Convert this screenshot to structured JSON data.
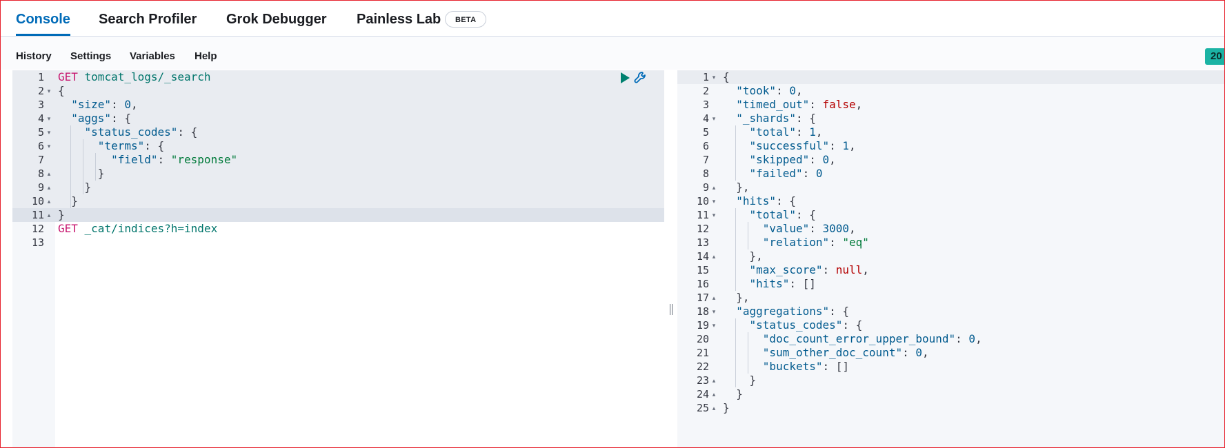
{
  "tabs": [
    {
      "label": "Console",
      "active": true
    },
    {
      "label": "Search Profiler",
      "active": false
    },
    {
      "label": "Grok Debugger",
      "active": false
    },
    {
      "label": "Painless Lab",
      "active": false,
      "badge": "BETA"
    }
  ],
  "toolbar": {
    "items": [
      "History",
      "Settings",
      "Variables",
      "Help"
    ],
    "status": "20"
  },
  "request_editor": {
    "actions": {
      "run": "play-icon",
      "settings": "wrench-icon"
    },
    "lines": [
      {
        "n": "1",
        "fold": "",
        "tokens": [
          {
            "t": "GET",
            "c": "method"
          },
          {
            "t": " tomcat_logs/_search",
            "c": "url"
          }
        ]
      },
      {
        "n": "2",
        "fold": "▾",
        "tokens": [
          {
            "t": "{",
            "c": "punc"
          }
        ]
      },
      {
        "n": "3",
        "fold": "",
        "tokens": [
          {
            "t": "  ",
            "c": "punc"
          },
          {
            "t": "\"size\"",
            "c": "key"
          },
          {
            "t": ": ",
            "c": "punc"
          },
          {
            "t": "0",
            "c": "num"
          },
          {
            "t": ",",
            "c": "punc"
          }
        ]
      },
      {
        "n": "4",
        "fold": "▾",
        "tokens": [
          {
            "t": "  ",
            "c": "punc"
          },
          {
            "t": "\"aggs\"",
            "c": "key"
          },
          {
            "t": ": {",
            "c": "punc"
          }
        ]
      },
      {
        "n": "5",
        "fold": "▾",
        "tokens": [
          {
            "t": "    ",
            "c": "punc"
          },
          {
            "t": "\"status_codes\"",
            "c": "key"
          },
          {
            "t": ": {",
            "c": "punc"
          }
        ]
      },
      {
        "n": "6",
        "fold": "▾",
        "tokens": [
          {
            "t": "      ",
            "c": "punc"
          },
          {
            "t": "\"terms\"",
            "c": "key"
          },
          {
            "t": ": {",
            "c": "punc"
          }
        ]
      },
      {
        "n": "7",
        "fold": "",
        "tokens": [
          {
            "t": "        ",
            "c": "punc"
          },
          {
            "t": "\"field\"",
            "c": "key"
          },
          {
            "t": ": ",
            "c": "punc"
          },
          {
            "t": "\"response\"",
            "c": "str"
          }
        ]
      },
      {
        "n": "8",
        "fold": "▴",
        "tokens": [
          {
            "t": "      }",
            "c": "punc"
          }
        ]
      },
      {
        "n": "9",
        "fold": "▴",
        "tokens": [
          {
            "t": "    }",
            "c": "punc"
          }
        ]
      },
      {
        "n": "10",
        "fold": "▴",
        "tokens": [
          {
            "t": "  }",
            "c": "punc"
          }
        ]
      },
      {
        "n": "11",
        "fold": "▴",
        "tokens": [
          {
            "t": "}",
            "c": "punc"
          }
        ]
      },
      {
        "n": "12",
        "fold": "",
        "tokens": [
          {
            "t": "GET",
            "c": "method"
          },
          {
            "t": " _cat/indices?h=index",
            "c": "url"
          }
        ]
      },
      {
        "n": "13",
        "fold": "",
        "tokens": []
      }
    ]
  },
  "response_editor": {
    "lines": [
      {
        "n": "1",
        "fold": "▾",
        "tokens": [
          {
            "t": "{",
            "c": "punc"
          }
        ]
      },
      {
        "n": "2",
        "fold": "",
        "tokens": [
          {
            "t": "  ",
            "c": "punc"
          },
          {
            "t": "\"took\"",
            "c": "key"
          },
          {
            "t": ": ",
            "c": "punc"
          },
          {
            "t": "0",
            "c": "num"
          },
          {
            "t": ",",
            "c": "punc"
          }
        ]
      },
      {
        "n": "3",
        "fold": "",
        "tokens": [
          {
            "t": "  ",
            "c": "punc"
          },
          {
            "t": "\"timed_out\"",
            "c": "key"
          },
          {
            "t": ": ",
            "c": "punc"
          },
          {
            "t": "false",
            "c": "bool"
          },
          {
            "t": ",",
            "c": "punc"
          }
        ]
      },
      {
        "n": "4",
        "fold": "▾",
        "tokens": [
          {
            "t": "  ",
            "c": "punc"
          },
          {
            "t": "\"_shards\"",
            "c": "key"
          },
          {
            "t": ": {",
            "c": "punc"
          }
        ]
      },
      {
        "n": "5",
        "fold": "",
        "tokens": [
          {
            "t": "    ",
            "c": "punc"
          },
          {
            "t": "\"total\"",
            "c": "key"
          },
          {
            "t": ": ",
            "c": "punc"
          },
          {
            "t": "1",
            "c": "num"
          },
          {
            "t": ",",
            "c": "punc"
          }
        ]
      },
      {
        "n": "6",
        "fold": "",
        "tokens": [
          {
            "t": "    ",
            "c": "punc"
          },
          {
            "t": "\"successful\"",
            "c": "key"
          },
          {
            "t": ": ",
            "c": "punc"
          },
          {
            "t": "1",
            "c": "num"
          },
          {
            "t": ",",
            "c": "punc"
          }
        ]
      },
      {
        "n": "7",
        "fold": "",
        "tokens": [
          {
            "t": "    ",
            "c": "punc"
          },
          {
            "t": "\"skipped\"",
            "c": "key"
          },
          {
            "t": ": ",
            "c": "punc"
          },
          {
            "t": "0",
            "c": "num"
          },
          {
            "t": ",",
            "c": "punc"
          }
        ]
      },
      {
        "n": "8",
        "fold": "",
        "tokens": [
          {
            "t": "    ",
            "c": "punc"
          },
          {
            "t": "\"failed\"",
            "c": "key"
          },
          {
            "t": ": ",
            "c": "punc"
          },
          {
            "t": "0",
            "c": "num"
          }
        ]
      },
      {
        "n": "9",
        "fold": "▴",
        "tokens": [
          {
            "t": "  },",
            "c": "punc"
          }
        ]
      },
      {
        "n": "10",
        "fold": "▾",
        "tokens": [
          {
            "t": "  ",
            "c": "punc"
          },
          {
            "t": "\"hits\"",
            "c": "key"
          },
          {
            "t": ": {",
            "c": "punc"
          }
        ]
      },
      {
        "n": "11",
        "fold": "▾",
        "tokens": [
          {
            "t": "    ",
            "c": "punc"
          },
          {
            "t": "\"total\"",
            "c": "key"
          },
          {
            "t": ": {",
            "c": "punc"
          }
        ]
      },
      {
        "n": "12",
        "fold": "",
        "tokens": [
          {
            "t": "      ",
            "c": "punc"
          },
          {
            "t": "\"value\"",
            "c": "key"
          },
          {
            "t": ": ",
            "c": "punc"
          },
          {
            "t": "3000",
            "c": "num"
          },
          {
            "t": ",",
            "c": "punc"
          }
        ]
      },
      {
        "n": "13",
        "fold": "",
        "tokens": [
          {
            "t": "      ",
            "c": "punc"
          },
          {
            "t": "\"relation\"",
            "c": "key"
          },
          {
            "t": ": ",
            "c": "punc"
          },
          {
            "t": "\"eq\"",
            "c": "str"
          }
        ]
      },
      {
        "n": "14",
        "fold": "▴",
        "tokens": [
          {
            "t": "    },",
            "c": "punc"
          }
        ]
      },
      {
        "n": "15",
        "fold": "",
        "tokens": [
          {
            "t": "    ",
            "c": "punc"
          },
          {
            "t": "\"max_score\"",
            "c": "key"
          },
          {
            "t": ": ",
            "c": "punc"
          },
          {
            "t": "null",
            "c": "bool"
          },
          {
            "t": ",",
            "c": "punc"
          }
        ]
      },
      {
        "n": "16",
        "fold": "",
        "tokens": [
          {
            "t": "    ",
            "c": "punc"
          },
          {
            "t": "\"hits\"",
            "c": "key"
          },
          {
            "t": ": []",
            "c": "punc"
          }
        ]
      },
      {
        "n": "17",
        "fold": "▴",
        "tokens": [
          {
            "t": "  },",
            "c": "punc"
          }
        ]
      },
      {
        "n": "18",
        "fold": "▾",
        "tokens": [
          {
            "t": "  ",
            "c": "punc"
          },
          {
            "t": "\"aggregations\"",
            "c": "key"
          },
          {
            "t": ": {",
            "c": "punc"
          }
        ]
      },
      {
        "n": "19",
        "fold": "▾",
        "tokens": [
          {
            "t": "    ",
            "c": "punc"
          },
          {
            "t": "\"status_codes\"",
            "c": "key"
          },
          {
            "t": ": {",
            "c": "punc"
          }
        ]
      },
      {
        "n": "20",
        "fold": "",
        "tokens": [
          {
            "t": "      ",
            "c": "punc"
          },
          {
            "t": "\"doc_count_error_upper_bound\"",
            "c": "key"
          },
          {
            "t": ": ",
            "c": "punc"
          },
          {
            "t": "0",
            "c": "num"
          },
          {
            "t": ",",
            "c": "punc"
          }
        ]
      },
      {
        "n": "21",
        "fold": "",
        "tokens": [
          {
            "t": "      ",
            "c": "punc"
          },
          {
            "t": "\"sum_other_doc_count\"",
            "c": "key"
          },
          {
            "t": ": ",
            "c": "punc"
          },
          {
            "t": "0",
            "c": "num"
          },
          {
            "t": ",",
            "c": "punc"
          }
        ]
      },
      {
        "n": "22",
        "fold": "",
        "tokens": [
          {
            "t": "      ",
            "c": "punc"
          },
          {
            "t": "\"buckets\"",
            "c": "key"
          },
          {
            "t": ": []",
            "c": "punc"
          }
        ]
      },
      {
        "n": "23",
        "fold": "▴",
        "tokens": [
          {
            "t": "    }",
            "c": "punc"
          }
        ]
      },
      {
        "n": "24",
        "fold": "▴",
        "tokens": [
          {
            "t": "  }",
            "c": "punc"
          }
        ]
      },
      {
        "n": "25",
        "fold": "▴",
        "tokens": [
          {
            "t": "}",
            "c": "punc"
          }
        ]
      }
    ]
  }
}
